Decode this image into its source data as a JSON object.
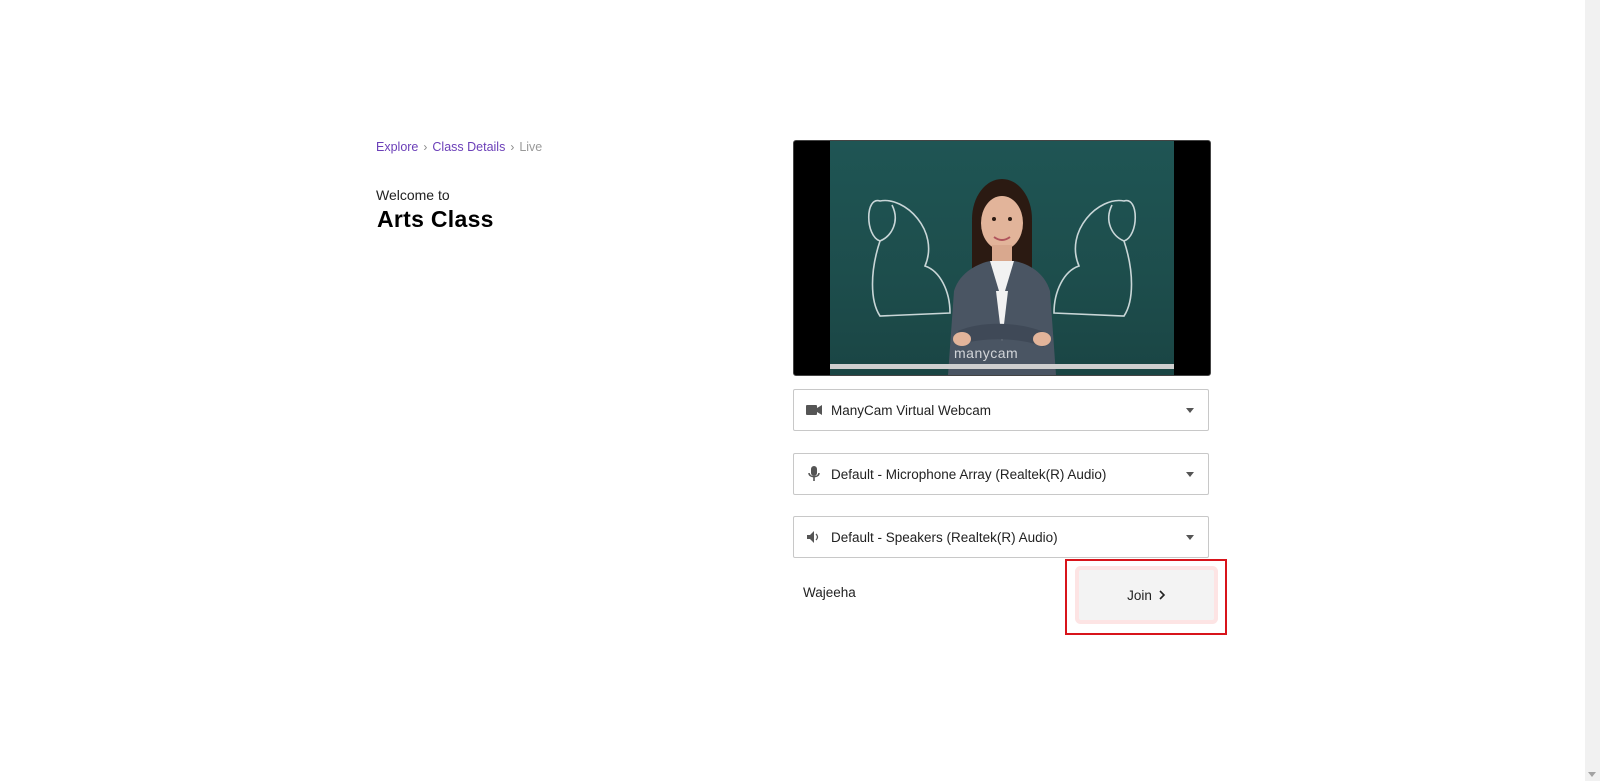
{
  "breadcrumb": {
    "items": [
      "Explore",
      "Class Details"
    ],
    "current": "Live"
  },
  "header": {
    "welcome": "Welcome to",
    "class_name": "Arts Class"
  },
  "video": {
    "watermark": "manycam"
  },
  "devices": {
    "camera": "ManyCam Virtual Webcam",
    "microphone": "Default - Microphone Array (Realtek(R) Audio)",
    "speaker": "Default - Speakers (Realtek(R) Audio)"
  },
  "user": {
    "name": "Wajeeha"
  },
  "actions": {
    "join_label": "Join"
  },
  "colors": {
    "link": "#6b3fb8",
    "highlight": "#d8141b"
  }
}
